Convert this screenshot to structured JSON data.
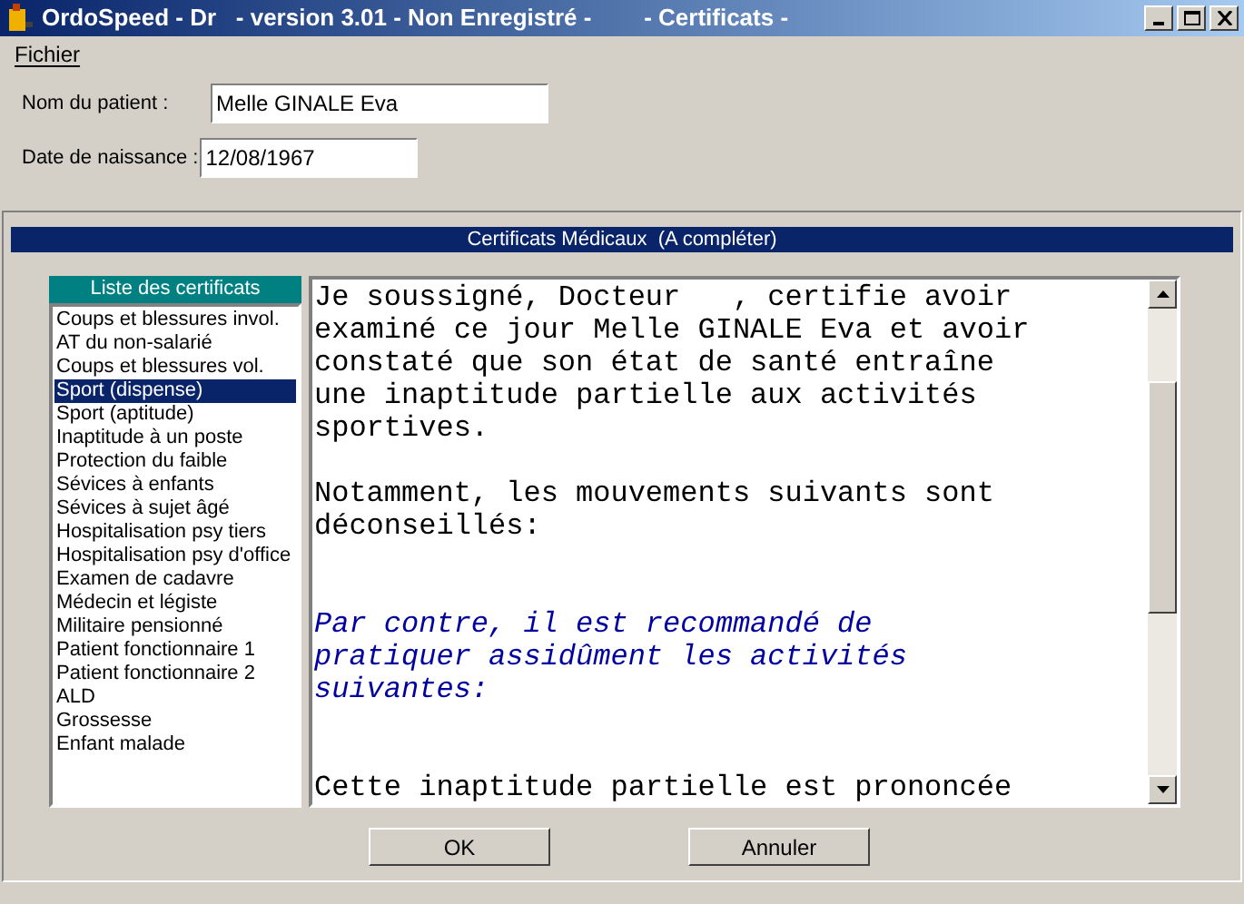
{
  "window": {
    "title": "OrdoSpeed - Dr   - version 3.01 - Non Enregistré -        - Certificats -"
  },
  "menu": [
    {
      "label": "Fichier"
    }
  ],
  "fields": [
    {
      "label": "Nom du patient :",
      "value": "Melle GINALE Eva"
    },
    {
      "label": "Date de naissance :",
      "value": "12/08/1967"
    }
  ],
  "panel": {
    "title": "Certificats Médicaux  (A compléter)"
  },
  "list": {
    "title": "Liste des certificats",
    "items": [
      {
        "label": "Coups et blessures invol.",
        "selected": false
      },
      {
        "label": "AT du non-salarié",
        "selected": false
      },
      {
        "label": "Coups et blessures vol.",
        "selected": false
      },
      {
        "label": "Sport (dispense)",
        "selected": true
      },
      {
        "label": "Sport (aptitude)",
        "selected": false
      },
      {
        "label": "Inaptitude à un poste",
        "selected": false
      },
      {
        "label": "Protection du faible",
        "selected": false
      },
      {
        "label": "Sévices à enfants",
        "selected": false
      },
      {
        "label": "Sévices à sujet âgé",
        "selected": false
      },
      {
        "label": "Hospitalisation psy tiers",
        "selected": false
      },
      {
        "label": "Hospitalisation psy d'office",
        "selected": false
      },
      {
        "label": "Examen de cadavre",
        "selected": false
      },
      {
        "label": "Médecin et légiste",
        "selected": false
      },
      {
        "label": "Militaire pensionné",
        "selected": false
      },
      {
        "label": "Patient fonctionnaire 1",
        "selected": false
      },
      {
        "label": "Patient fonctionnaire 2",
        "selected": false
      },
      {
        "label": "ALD",
        "selected": false
      },
      {
        "label": "Grossesse",
        "selected": false
      },
      {
        "label": "Enfant malade",
        "selected": false
      }
    ]
  },
  "document": {
    "paragraphs": [
      {
        "kind": "normal",
        "lines": [
          "Je soussigné, Docteur   , certifie avoir",
          "examiné ce jour Melle GINALE Eva et avoir",
          "constaté que son état de santé entraîne",
          "une inaptitude partielle aux activités",
          "sportives."
        ]
      },
      {
        "kind": "normal",
        "lines": [
          "Notamment, les mouvements suivants sont",
          "déconseillés:"
        ]
      },
      {
        "kind": "emphasis",
        "lines": [
          "Par contre, il est recommandé de",
          "pratiquer assidûment les activités",
          "suivantes:"
        ]
      },
      {
        "kind": "normal",
        "lines": [
          "Cette inaptitude partielle est prononcée"
        ]
      }
    ]
  },
  "buttons": [
    {
      "label": "OK"
    },
    {
      "label": "Annuler"
    }
  ]
}
